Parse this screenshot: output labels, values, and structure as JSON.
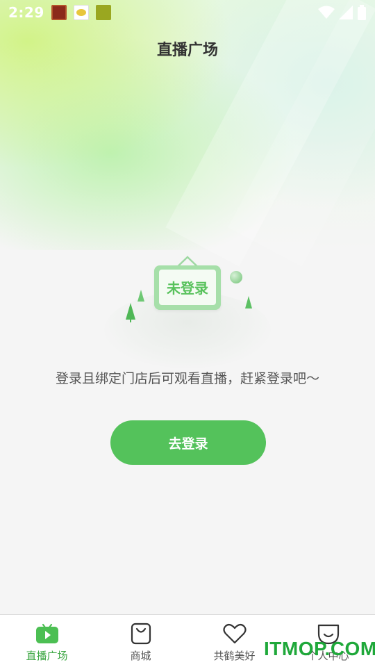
{
  "status_bar": {
    "time": "2:29",
    "icons": [
      "wifi-icon",
      "signal-icon",
      "battery-icon"
    ]
  },
  "header": {
    "title": "直播广场"
  },
  "empty_state": {
    "sign_text": "未登录",
    "message": "登录且绑定门店后可观看直播，赶紧登录吧～"
  },
  "actions": {
    "login_label": "去登录"
  },
  "bottom_nav": {
    "items": [
      {
        "label": "直播广场",
        "icon": "live-tv-icon",
        "active": true
      },
      {
        "label": "商城",
        "icon": "shopping-bag-icon",
        "active": false
      },
      {
        "label": "共鹤美好",
        "icon": "heart-icon",
        "active": false
      },
      {
        "label": "个人中心",
        "icon": "smile-face-icon",
        "active": false
      }
    ]
  },
  "watermark": "ITMOP.COM",
  "colors": {
    "accent": "#54c25b",
    "active_nav": "#3fa845",
    "title": "#333333",
    "text": "#555555"
  }
}
